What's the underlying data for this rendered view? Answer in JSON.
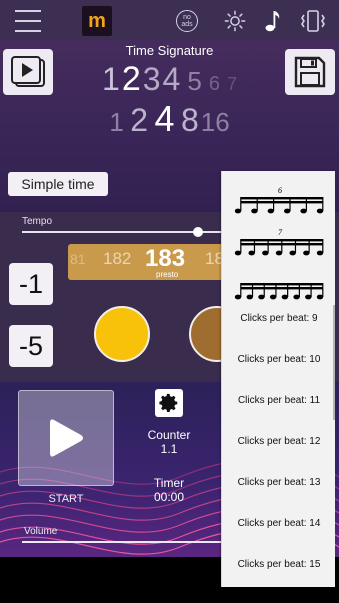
{
  "topbar": {
    "menu_icon": "hamburger-menu-icon",
    "logo_text": "m",
    "noads_label": "no ads",
    "icons": [
      "sun-icon",
      "music-note-icon",
      "vibrate-icon"
    ]
  },
  "time_signature": {
    "title": "Time Signature",
    "numerators": [
      "1",
      "2",
      "3",
      "4",
      "5",
      "6",
      "7"
    ],
    "denominators": [
      "1",
      "2",
      "4",
      "8",
      "16"
    ],
    "selected_numerator": "2",
    "selected_denominator": "4"
  },
  "simple_time_label": "Simple time",
  "tempo": {
    "label": "Tempo",
    "slider_level": 0.88,
    "bpm_prev2": "81",
    "bpm_prev": "182",
    "bpm_current": "183",
    "bpm_next": "18",
    "tempo_name": "presto"
  },
  "increment_buttons": [
    "-1",
    "-5"
  ],
  "beats": [
    {
      "color": "#f8c20b"
    },
    {
      "color": "#a06d30"
    }
  ],
  "start": {
    "label": "START"
  },
  "counter": {
    "label": "Counter",
    "value": "1.1"
  },
  "timer": {
    "label": "Timer",
    "value": "00:00"
  },
  "volume": {
    "label": "Volume"
  },
  "subdivision_menu": {
    "notation_items": [
      {
        "tuplet": "6",
        "notes": 6
      },
      {
        "tuplet": "7",
        "notes": 7
      },
      {
        "tuplet": "",
        "notes": 8
      }
    ],
    "items": [
      "Clicks per beat: 9",
      "Clicks per beat: 10",
      "Clicks per beat: 11",
      "Clicks per beat: 12",
      "Clicks per beat: 13",
      "Clicks per beat: 14",
      "Clicks per beat: 15"
    ]
  },
  "colors": {
    "accent_yellow": "#f8c20b",
    "bpm_box": "#c99a4b",
    "background": "#2b1d4a"
  }
}
